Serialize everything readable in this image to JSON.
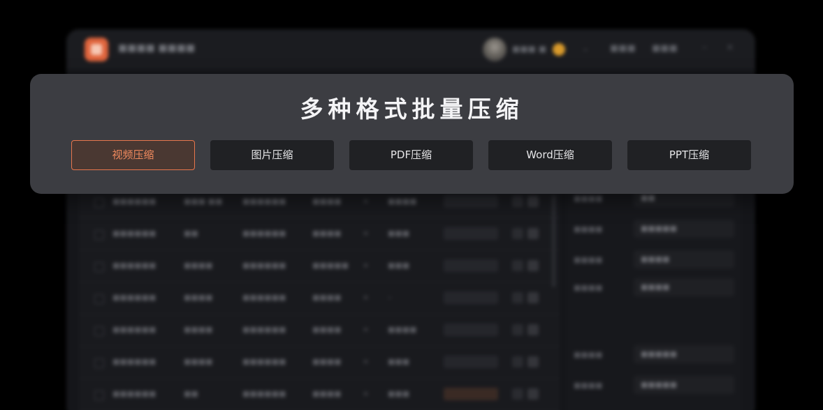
{
  "overlay": {
    "title": "多种格式批量压缩",
    "active_tab": 0,
    "tabs": [
      {
        "label": "视频压缩"
      },
      {
        "label": "图片压缩"
      },
      {
        "label": "PDF压缩"
      },
      {
        "label": "Word压缩"
      },
      {
        "label": "PPT压缩"
      }
    ]
  },
  "colors": {
    "overlay_background": "#3c3d42",
    "tab_background": "#202124",
    "active_accent": "#e8764c",
    "active_text": "#f08a5e",
    "title_text": "#f4f4f6"
  }
}
